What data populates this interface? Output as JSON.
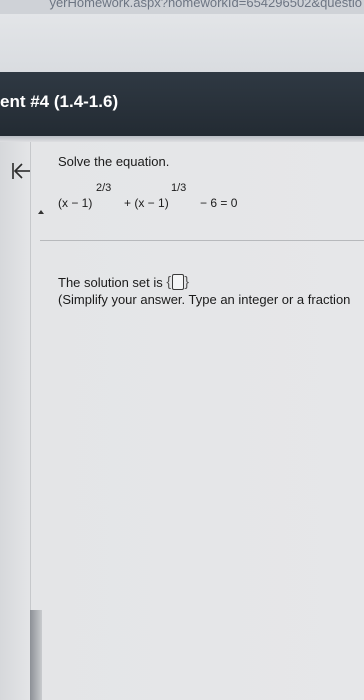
{
  "browser": {
    "url_fragment": "yerHomework.aspx?homeworkId=654296502&questio"
  },
  "header": {
    "title": "ent #4 (1.4-1.6)"
  },
  "question": {
    "prompt": "Solve the equation.",
    "equation": {
      "term1": "(x − 1)",
      "exp1": "2/3",
      "term2": "+ (x − 1)",
      "exp2": "1/3",
      "rest": "− 6 = 0"
    },
    "solution_prefix": "The solution set is",
    "answer_value": "",
    "hint": "(Simplify your answer. Type an integer or a fraction"
  },
  "icons": {
    "back": "back-to-start-arrow-icon",
    "scroll": "caret-up-icon"
  }
}
